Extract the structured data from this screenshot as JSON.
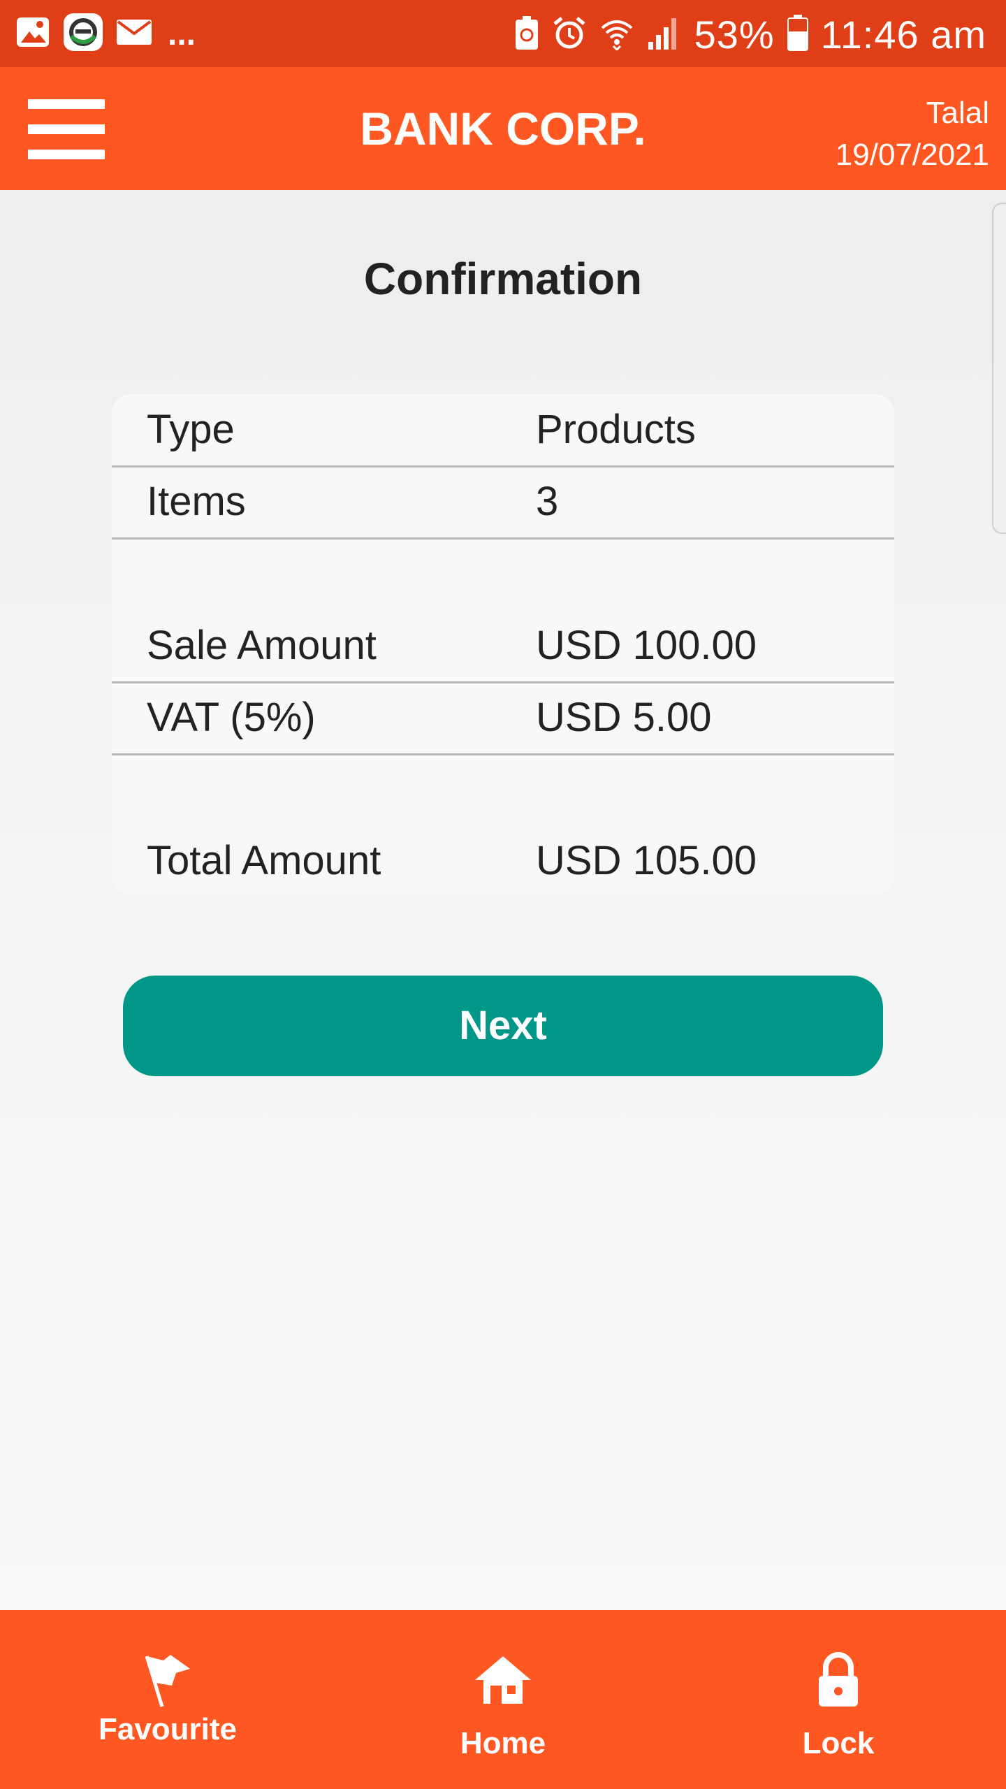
{
  "status_bar": {
    "left_icons": [
      "gallery-icon",
      "app-icon",
      "mail-icon"
    ],
    "more_indicator": "...",
    "right_icons": [
      "battery-saver-icon",
      "alarm-icon",
      "wifi-icon",
      "signal-icon"
    ],
    "battery_percent": "53%",
    "time": "11:46 am"
  },
  "app_bar": {
    "title": "BANK CORP.",
    "user_name": "Talal",
    "date": "19/07/2021"
  },
  "page": {
    "title": "Confirmation"
  },
  "summary": {
    "rows": [
      {
        "label": "Type",
        "value": "Products"
      },
      {
        "label": "Items",
        "value": "3"
      },
      {
        "label": "Sale Amount",
        "value": "USD 100.00"
      },
      {
        "label": "VAT (5%)",
        "value": "USD 5.00"
      },
      {
        "label": "Total Amount",
        "value": "USD 105.00"
      }
    ]
  },
  "actions": {
    "next_label": "Next"
  },
  "bottom_nav": {
    "items": [
      {
        "label": "Favourite",
        "icon": "flag-icon"
      },
      {
        "label": "Home",
        "icon": "home-icon"
      },
      {
        "label": "Lock",
        "icon": "lock-icon"
      }
    ]
  },
  "colors": {
    "status_bar": "#e03e16",
    "app_bar": "#ff5722",
    "primary_button": "#009688",
    "bottom_nav": "#ff5722"
  }
}
